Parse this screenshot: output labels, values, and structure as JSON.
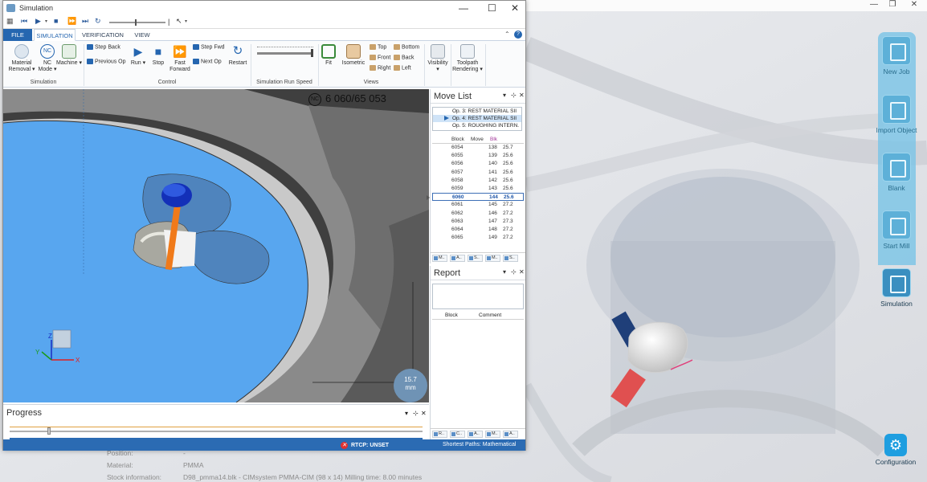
{
  "window": {
    "title": "Simulation",
    "tabs": [
      "FILE",
      "SIMULATION",
      "VERIFICATION",
      "VIEW"
    ],
    "active_tab": "SIMULATION"
  },
  "ribbon": {
    "simulation": {
      "material_removal": "Material Removal",
      "nc_mode": "NC Mode",
      "machine": "Machine",
      "group": "Simulation"
    },
    "control": {
      "step_back": "Step Back",
      "previous_op": "Previous Op",
      "run": "Run",
      "stop": "Stop",
      "fast_forward": "Fast Forward",
      "step_fwd": "Step Fwd",
      "next_op": "Next Op",
      "restart": "Restart",
      "group": "Control"
    },
    "speed": {
      "group": "Simulation Run Speed"
    },
    "views": {
      "fit": "Fit",
      "isometric": "Isometric",
      "top": "Top",
      "front": "Front",
      "right": "Right",
      "bottom": "Bottom",
      "back": "Back",
      "left": "Left",
      "group": "Views"
    },
    "visibility": "Visibility",
    "toolpath_rendering": "Toolpath Rendering"
  },
  "viewport": {
    "nc_readout": "6 060/65 053",
    "scale_value": "15.7",
    "scale_unit": "mm"
  },
  "move_list": {
    "title": "Move List",
    "ops": [
      {
        "label": "Op. 3: REST MATERIAL SII",
        "selected": false
      },
      {
        "label": "Op. 4: REST MATERIAL SII",
        "selected": true
      },
      {
        "label": "Op. 5: ROUGHING INTERN.",
        "selected": false
      }
    ],
    "columns": [
      "Block",
      "Move",
      "Blk"
    ],
    "rows": [
      {
        "block": "6054",
        "move": "138",
        "blk": "25.7",
        "current": false
      },
      {
        "block": "6055",
        "move": "139",
        "blk": "25.6",
        "current": false
      },
      {
        "block": "6056",
        "move": "140",
        "blk": "25.6",
        "current": false
      },
      {
        "block": "6057",
        "move": "141",
        "blk": "25.6",
        "current": false
      },
      {
        "block": "6058",
        "move": "142",
        "blk": "25.6",
        "current": false
      },
      {
        "block": "6059",
        "move": "143",
        "blk": "25.6",
        "current": false
      },
      {
        "block": "6060",
        "move": "144",
        "blk": "25.6",
        "current": true
      },
      {
        "block": "6061",
        "move": "145",
        "blk": "27.2",
        "current": false
      },
      {
        "block": "6062",
        "move": "146",
        "blk": "27.2",
        "current": false
      },
      {
        "block": "6063",
        "move": "147",
        "blk": "27.3",
        "current": false
      },
      {
        "block": "6064",
        "move": "148",
        "blk": "27.2",
        "current": false
      },
      {
        "block": "6065",
        "move": "149",
        "blk": "27.2",
        "current": false
      }
    ],
    "tabs": [
      "M..",
      "A..",
      "S..",
      "M..",
      "S.."
    ]
  },
  "report": {
    "title": "Report",
    "columns": [
      "Block",
      "Comment"
    ],
    "tabs": [
      "R..",
      "C..",
      "A..",
      "M..",
      "A.."
    ]
  },
  "progress": {
    "title": "Progress"
  },
  "status": {
    "rtcp": "RTCP: UNSET",
    "shortest_paths": "Shortest Paths: Mathematical"
  },
  "app": {
    "side_buttons": [
      "New Job",
      "Import Object",
      "Blank",
      "Start Mill",
      "Simulation"
    ],
    "configuration": "Configuration",
    "info": [
      {
        "label": "Position:",
        "value": "-"
      },
      {
        "label": "Material:",
        "value": "PMMA"
      },
      {
        "label": "Stock information:",
        "value": "D98_pmma14.blk - CIMsystem PMMA-CIM (98 x 14) Milling time: 8.00 minutes"
      }
    ]
  }
}
